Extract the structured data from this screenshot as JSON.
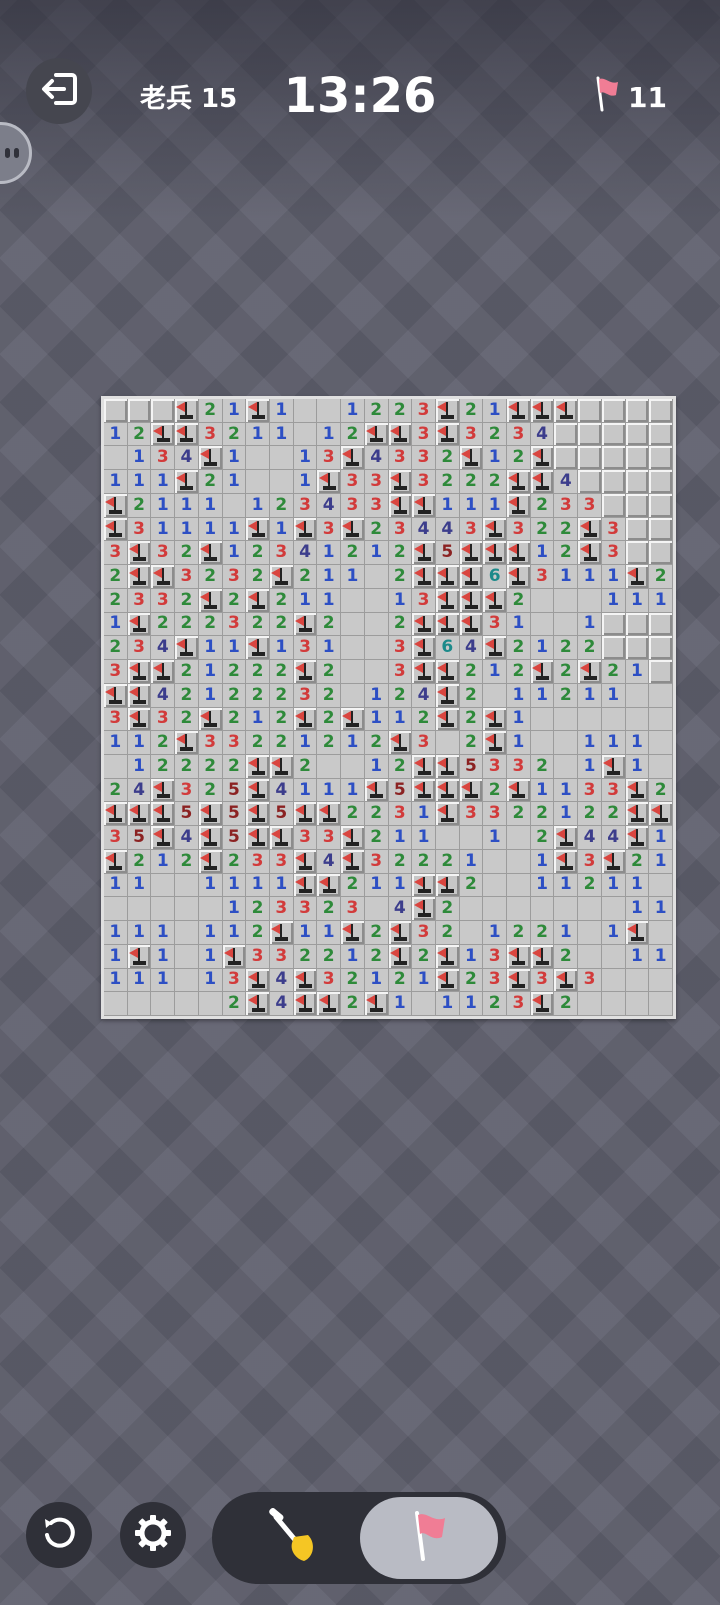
{
  "header": {
    "rank_label": "老兵 15",
    "timer": "13:26",
    "flags_remaining": "11"
  },
  "icons": {
    "exit": "exit-icon",
    "chat": "chat-icon",
    "restart": "restart-icon",
    "settings": "gear-icon",
    "dig": "shovel-icon",
    "flag": "flag-icon"
  },
  "toolbar": {
    "selected_tool": "flag"
  },
  "board": {
    "columns": 24,
    "rows": 26,
    "legend": "U = unopened, F = flag, . = empty, digit = count",
    "cells": [
      "UUUF21F1..1223F21FFFUUUU",
      "12FF3211.12FF3F3234UUUUU",
      ".134F1..13F4332F12FUUUUU",
      "111F21..1F33F3222FF4UUUU",
      "F2111.123433FF111F233UUU",
      "F31111F1F3F23443F322F3UU",
      "3F32F12341212F5FFF12F3UU",
      "2FF3232F211.2FFF6F3111F2",
      "2332F2F211..13FFF2...111",
      "1F222322F2..2FFF31..1UUU",
      "234F11F131..3F64F2122UUU",
      "3FF21222F2..3FF212F2F21U",
      "FF42122232.124F2.11211..",
      "3F32F212F2F112F2F1......",
      "112F33221212F3.2F1..111.",
      ".12222FF2..12FF5332.1F1.",
      "24F325F4111F5FFF2F1133F2",
      "FFF5F5F5FF2231F3322122FF",
      "35F4F5FF33F211..1.2F44F1",
      "F212F233F4F32221..1F3F21",
      "11..1111FF211FF2..11211.",
      ".....123323.4F2.......11",
      "111.112F11F2F32.1221.1F.",
      "1F1.1F332212F2F13FF2..11",
      "111.13F4F32121F23F3F3...",
      ".....2F4FF2F1.1123F2...."
    ]
  }
}
